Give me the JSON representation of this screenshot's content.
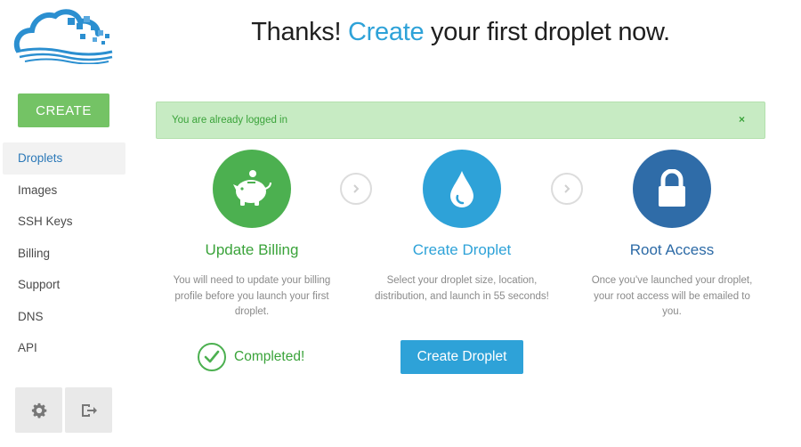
{
  "sidebar": {
    "logo_icon": "cloud-logo-icon",
    "create_label": "CREATE",
    "items": [
      {
        "label": "Droplets",
        "active": true
      },
      {
        "label": "Images"
      },
      {
        "label": "SSH Keys"
      },
      {
        "label": "Billing"
      },
      {
        "label": "Support"
      },
      {
        "label": "DNS"
      },
      {
        "label": "API"
      }
    ],
    "footer": {
      "settings_icon": "gear-icon",
      "logout_icon": "logout-icon"
    }
  },
  "header": {
    "prefix": "Thanks!",
    "accent": "Create",
    "suffix": "your first droplet now."
  },
  "alert": {
    "message": "You are already logged in",
    "close": "×"
  },
  "steps": [
    {
      "icon": "piggy-bank-icon",
      "title": "Update Billing",
      "description": "You will need to update your billing profile before you launch your first droplet."
    },
    {
      "icon": "droplet-icon",
      "title": "Create Droplet",
      "description": "Select your droplet size, location, distribution, and launch in 55 seconds!"
    },
    {
      "icon": "lock-icon",
      "title": "Root Access",
      "description": "Once you've launched your droplet, your root access will be emailed to you."
    }
  ],
  "completed_label": "Completed!",
  "create_droplet_button": "Create Droplet",
  "colors": {
    "green": "#4cb050",
    "blue": "#2ea2d8",
    "dark_blue": "#2f6ca8",
    "create_button": "#74c365",
    "alert_bg": "#c7ebc3"
  }
}
